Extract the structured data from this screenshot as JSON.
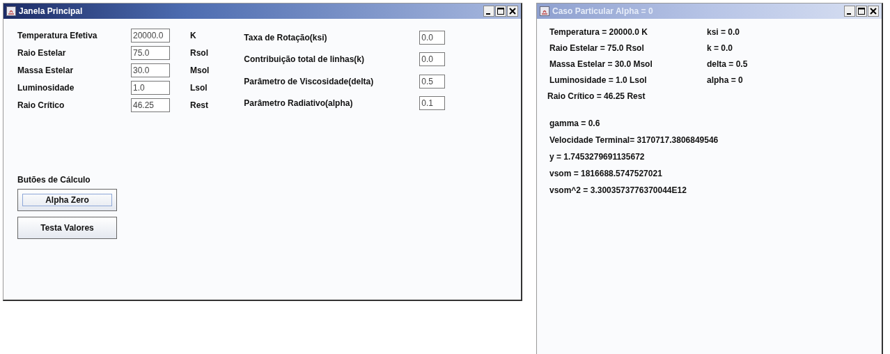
{
  "main_window": {
    "title": "Janela Principal",
    "active": true,
    "left_fields": [
      {
        "label": "Temperatura Efetiva",
        "value": "20000.0",
        "unit": "K"
      },
      {
        "label": "Raio Estelar",
        "value": "75.0",
        "unit": "Rsol"
      },
      {
        "label": "Massa Estelar",
        "value": "30.0",
        "unit": "Msol"
      },
      {
        "label": "Luminosidade",
        "value": "1.0",
        "unit": "Lsol"
      },
      {
        "label": "Raio Crítico",
        "value": "46.25",
        "unit": "Rest"
      }
    ],
    "right_fields": [
      {
        "label": "Taxa de Rotação(ksi)",
        "value": "0.0"
      },
      {
        "label": "Contribuição total de linhas(k)",
        "value": "0.0"
      },
      {
        "label": "Parâmetro de Viscosidade(delta)",
        "value": "0.5"
      },
      {
        "label": "Parâmetro Radiativo(alpha)",
        "value": "0.1"
      }
    ],
    "section_label": "Butões de Cálculo",
    "buttons": [
      {
        "label": "Alpha Zero",
        "focused": true
      },
      {
        "label": "Testa Valores",
        "focused": false
      }
    ]
  },
  "result_window": {
    "title": "Caso Particular Alpha = 0",
    "active": false,
    "pairs": [
      {
        "left": "Temperatura = 20000.0 K",
        "right": "ksi = 0.0"
      },
      {
        "left": "Raio Estelar = 75.0 Rsol",
        "right": "k = 0.0"
      },
      {
        "left": "Massa Estelar = 30.0 Msol",
        "right": "delta = 0.5"
      },
      {
        "left": "Luminosidade = 1.0 Lsol",
        "right": "alpha = 0"
      }
    ],
    "critical": "Raio Crítico = 46.25 Rest",
    "results": [
      "gamma = 0.6",
      "Velocidade Terminal= 3170717.3806849546",
      "y = 1.7453279691135672",
      "vsom = 1816688.5747527021",
      "vsom^2 = 3.3003573776370044E12"
    ]
  }
}
